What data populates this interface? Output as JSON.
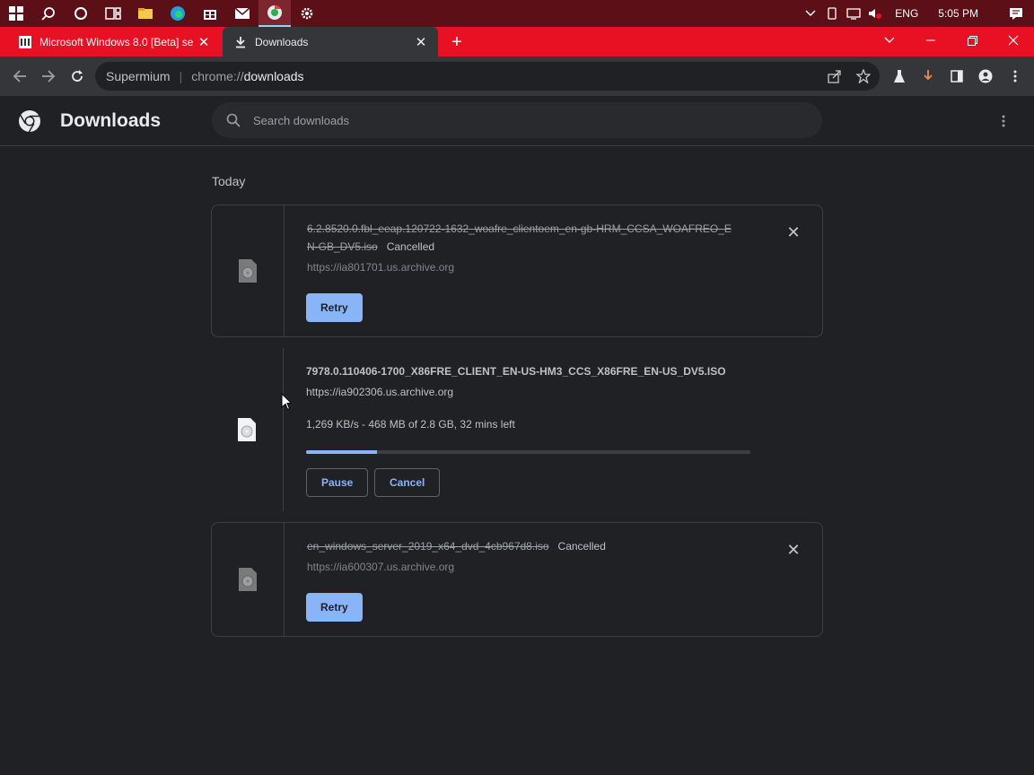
{
  "taskbar": {
    "icons": [
      "windows-start-icon",
      "search-icon",
      "cortana-icon",
      "task-view-icon",
      "file-explorer-icon",
      "edge-icon",
      "store-icon",
      "mail-icon",
      "supermium-icon",
      "settings-icon"
    ],
    "language": "ENG",
    "time": "5:05 PM"
  },
  "tabs": [
    {
      "title": "Microsoft Windows 8.0 [Beta] se",
      "active": false
    },
    {
      "title": "Downloads",
      "active": true
    }
  ],
  "toolbar": {
    "site_name": "Supermium",
    "url_scheme": "chrome://",
    "url_path": "downloads"
  },
  "page": {
    "title": "Downloads",
    "search_placeholder": "Search downloads",
    "date_heading": "Today"
  },
  "downloads": [
    {
      "filename": "6.2.8520.0.fbl_eeap.120722-1632_woafre_clientoem_en-gb-HRM_CCSA_WOAFREO_EN-GB_DV5.iso",
      "filename_line1": "6.2.8520.0.fbl_eeap.120722-1632_woafre_clientoem_en-gb-HRM_CCSA_WOAFREO_E",
      "filename_line2": "N-GB_DV5.iso",
      "status": "Cancelled",
      "url": "https://ia801701.us.archive.org",
      "action": "Retry"
    },
    {
      "filename": "7978.0.110406-1700_X86FRE_CLIENT_EN-US-HM3_CCS_X86FRE_EN-US_DV5.ISO",
      "url": "https://ia902306.us.archive.org",
      "progress_text": "1,269 KB/s - 468 MB of 2.8 GB, 32 mins left",
      "progress_fraction": 0.16,
      "pause_label": "Pause",
      "cancel_label": "Cancel"
    },
    {
      "filename": "en_windows_server_2019_x64_dvd_4cb967d8.iso",
      "status": "Cancelled",
      "url": "https://ia600307.us.archive.org",
      "action": "Retry"
    }
  ],
  "colors": {
    "accent": "#8ab4f8",
    "tabstrip": "#e81123",
    "taskbar": "#5c0f16"
  }
}
